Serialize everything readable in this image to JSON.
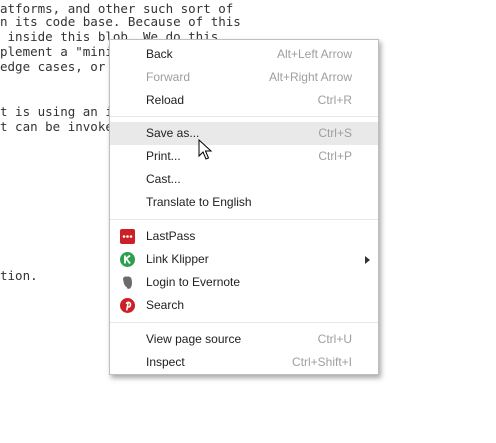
{
  "background": {
    "lines": [
      "atforms, and other such sort of",
      "n its code base. Because of this",
      " inside this blob. We do this",
      "plement a \"mini",
      "edge cases, or",
      "t is using an i",
      "t can be invoked",
      "tion."
    ]
  },
  "menu": {
    "items": [
      {
        "label": "Back",
        "shortcut": "Alt+Left Arrow"
      },
      {
        "label": "Forward",
        "shortcut": "Alt+Right Arrow"
      },
      {
        "label": "Reload",
        "shortcut": "Ctrl+R"
      },
      {
        "label": "Save as...",
        "shortcut": "Ctrl+S"
      },
      {
        "label": "Print...",
        "shortcut": "Ctrl+P"
      },
      {
        "label": "Cast..."
      },
      {
        "label": "Translate to English"
      },
      {
        "label": "LastPass",
        "icon": "lastpass-icon",
        "icon_color": "#cc2029"
      },
      {
        "label": "Link Klipper",
        "icon": "link-klipper-icon",
        "icon_color": "#2e9e4f"
      },
      {
        "label": "Login to Evernote",
        "icon": "evernote-icon",
        "icon_color": "#6b6b6b"
      },
      {
        "label": "Search",
        "icon": "pinterest-icon",
        "icon_color": "#cb2027"
      },
      {
        "label": "View page source",
        "shortcut": "Ctrl+U"
      },
      {
        "label": "Inspect",
        "shortcut": "Ctrl+Shift+I"
      }
    ]
  }
}
